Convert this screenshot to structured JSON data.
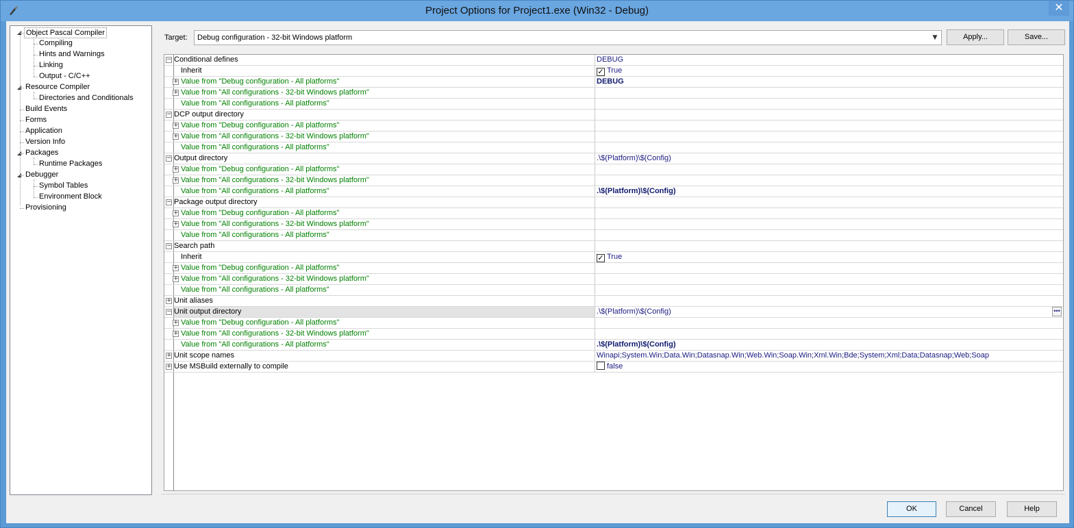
{
  "window": {
    "title": "Project Options for Project1.exe  (Win32 - Debug)",
    "close_glyph": "✕"
  },
  "tree": [
    {
      "label": "Object Pascal Compiler",
      "level": 0,
      "expanded": true,
      "selected": true
    },
    {
      "label": "Compiling",
      "level": 1
    },
    {
      "label": "Hints and Warnings",
      "level": 1
    },
    {
      "label": "Linking",
      "level": 1
    },
    {
      "label": "Output - C/C++",
      "level": 1
    },
    {
      "label": "Resource Compiler",
      "level": 0,
      "expanded": true
    },
    {
      "label": "Directories and Conditionals",
      "level": 1
    },
    {
      "label": "Build Events",
      "level": 0
    },
    {
      "label": "Forms",
      "level": 0
    },
    {
      "label": "Application",
      "level": 0
    },
    {
      "label": "Version Info",
      "level": 0
    },
    {
      "label": "Packages",
      "level": 0,
      "expanded": true
    },
    {
      "label": "Runtime Packages",
      "level": 1
    },
    {
      "label": "Debugger",
      "level": 0,
      "expanded": true
    },
    {
      "label": "Symbol Tables",
      "level": 1
    },
    {
      "label": "Environment Block",
      "level": 1
    },
    {
      "label": "Provisioning",
      "level": 0
    }
  ],
  "target": {
    "label": "Target:",
    "value": "Debug configuration - 32-bit Windows platform"
  },
  "buttons": {
    "apply": "Apply...",
    "save": "Save...",
    "ok": "OK",
    "cancel": "Cancel",
    "help": "Help"
  },
  "grid_rows": [
    {
      "name": "Conditional defines",
      "indent": 0,
      "expander": "minus",
      "value": "DEBUG"
    },
    {
      "name": "Inherit",
      "indent": 1,
      "value": "True",
      "checkbox": true,
      "checked": true
    },
    {
      "name": "Value from \"Debug configuration - All platforms\"",
      "indent": 1,
      "green": true,
      "expander": "plus",
      "value": "DEBUG",
      "bold": true
    },
    {
      "name": "Value from \"All configurations - 32-bit Windows platform\"",
      "indent": 1,
      "green": true,
      "expander": "plus",
      "value": ""
    },
    {
      "name": "Value from \"All configurations - All platforms\"",
      "indent": 1,
      "green": true,
      "value": ""
    },
    {
      "name": "DCP output directory",
      "indent": 0,
      "expander": "minus",
      "value": ""
    },
    {
      "name": "Value from \"Debug configuration - All platforms\"",
      "indent": 1,
      "green": true,
      "expander": "plus",
      "value": ""
    },
    {
      "name": "Value from \"All configurations - 32-bit Windows platform\"",
      "indent": 1,
      "green": true,
      "expander": "plus",
      "value": ""
    },
    {
      "name": "Value from \"All configurations - All platforms\"",
      "indent": 1,
      "green": true,
      "value": ""
    },
    {
      "name": "Output directory",
      "indent": 0,
      "expander": "minus",
      "value": ".\\$(Platform)\\$(Config)"
    },
    {
      "name": "Value from \"Debug configuration - All platforms\"",
      "indent": 1,
      "green": true,
      "expander": "plus",
      "value": ""
    },
    {
      "name": "Value from \"All configurations - 32-bit Windows platform\"",
      "indent": 1,
      "green": true,
      "expander": "plus",
      "value": ""
    },
    {
      "name": "Value from \"All configurations - All platforms\"",
      "indent": 1,
      "green": true,
      "value": ".\\$(Platform)\\$(Config)",
      "bold": true
    },
    {
      "name": "Package output directory",
      "indent": 0,
      "expander": "minus",
      "value": ""
    },
    {
      "name": "Value from \"Debug configuration - All platforms\"",
      "indent": 1,
      "green": true,
      "expander": "plus",
      "value": ""
    },
    {
      "name": "Value from \"All configurations - 32-bit Windows platform\"",
      "indent": 1,
      "green": true,
      "expander": "plus",
      "value": ""
    },
    {
      "name": "Value from \"All configurations - All platforms\"",
      "indent": 1,
      "green": true,
      "value": ""
    },
    {
      "name": "Search path",
      "indent": 0,
      "expander": "minus",
      "value": ""
    },
    {
      "name": "Inherit",
      "indent": 1,
      "value": "True",
      "checkbox": true,
      "checked": true
    },
    {
      "name": "Value from \"Debug configuration - All platforms\"",
      "indent": 1,
      "green": true,
      "expander": "plus",
      "value": ""
    },
    {
      "name": "Value from \"All configurations - 32-bit Windows platform\"",
      "indent": 1,
      "green": true,
      "expander": "plus",
      "value": ""
    },
    {
      "name": "Value from \"All configurations - All platforms\"",
      "indent": 1,
      "green": true,
      "value": ""
    },
    {
      "name": "Unit aliases",
      "indent": 0,
      "expander": "plus",
      "value": ""
    },
    {
      "name": "Unit output directory",
      "indent": 0,
      "expander": "minus",
      "value": ".\\$(Platform)\\$(Config)",
      "highlight": true,
      "ellipsis": true
    },
    {
      "name": "Value from \"Debug configuration - All platforms\"",
      "indent": 1,
      "green": true,
      "expander": "plus",
      "value": ""
    },
    {
      "name": "Value from \"All configurations - 32-bit Windows platform\"",
      "indent": 1,
      "green": true,
      "expander": "plus",
      "value": ""
    },
    {
      "name": "Value from \"All configurations - All platforms\"",
      "indent": 1,
      "green": true,
      "value": ".\\$(Platform)\\$(Config)",
      "bold": true
    },
    {
      "name": "Unit scope names",
      "indent": 0,
      "expander": "plus",
      "value": "Winapi;System.Win;Data.Win;Datasnap.Win;Web.Win;Soap.Win;Xml.Win;Bde;System;Xml;Data;Datasnap;Web;Soap"
    },
    {
      "name": "Use MSBuild externally to compile",
      "indent": 0,
      "expander": "plus",
      "value": "false",
      "checkbox": true,
      "checked": false
    }
  ]
}
